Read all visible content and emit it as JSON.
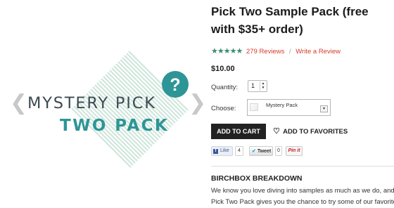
{
  "gallery": {
    "prev_arrow": "❮",
    "next_arrow": "❯",
    "image": {
      "line1": "MYSTERY PICK",
      "line2": "TWO PACK",
      "badge": "?",
      "colors": {
        "text_dark": "#3c4b52",
        "teal": "#2e9596",
        "stripes": "#cfe6dc"
      }
    }
  },
  "product": {
    "title": "Pick Two Sample Pack (free with $35+ order)",
    "rating": {
      "stars": "★★★★★",
      "value": 4.5,
      "reviews_label": "279 Reviews",
      "write_review_label": "Write a Review"
    },
    "price": "$10.00",
    "quantity": {
      "label": "Quantity:",
      "value": "1",
      "spin_up": "▲",
      "spin_down": "▼"
    },
    "choose": {
      "label": "Choose:",
      "selected": "Mystery Pack",
      "dropdown_icon": "▾"
    },
    "add_to_cart_label": "ADD TO CART",
    "favorites_label": "ADD TO FAVORITES",
    "favorites_icon": "♡"
  },
  "social": {
    "like_label": "Like",
    "like_icon": "f",
    "like_count": "4",
    "tweet_label": "Tweet",
    "tweet_icon": "✔",
    "tweet_count": "0",
    "pin_label": "Pin it"
  },
  "breakdown": {
    "title": "BIRCHBOX BREAKDOWN",
    "lines": [
      "We know you love diving into samples as much as we do, and t",
      "Pick Two Pack gives you the chance to try some of our favorite"
    ]
  },
  "colors": {
    "accent_red": "#d63c2a",
    "star_green": "#3b8d72",
    "button_dark": "#222222"
  }
}
